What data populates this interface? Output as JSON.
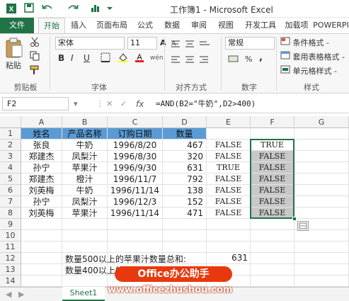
{
  "window": {
    "title": "工作簿1 - Microsoft Excel"
  },
  "tabs": [
    "文件",
    "开始",
    "插入",
    "页面布局",
    "公式",
    "数据",
    "审阅",
    "视图",
    "开发工具",
    "加载项",
    "POWERPI"
  ],
  "ribbon": {
    "clipboard": {
      "paste": "粘贴",
      "label": "剪贴板"
    },
    "font": {
      "name": "宋体",
      "size": "11",
      "bold": "B",
      "italic": "I",
      "underline": "U",
      "grow": "A",
      "shrink": "A",
      "wen": "wén",
      "label": "字体"
    },
    "alignment": {
      "label": "对齐方式"
    },
    "number": {
      "format": "常规",
      "percent": "%",
      "comma": ",",
      "label": "数字"
    },
    "styles": {
      "conditional": "条件格式 -",
      "table": "套用表格格式 -",
      "cell": "单元格样式 -",
      "label": "样式"
    }
  },
  "formula_bar": {
    "name_box": "F2",
    "fx": "fx",
    "formula": "=AND(B2=\"牛奶\",D2>400)"
  },
  "grid": {
    "columns": [
      "A",
      "B",
      "C",
      "D",
      "E",
      "F",
      "G"
    ],
    "rows": [
      "1",
      "2",
      "3",
      "4",
      "5",
      "6",
      "7",
      "8",
      "9",
      "10",
      "11",
      "12",
      "13",
      "14"
    ],
    "header": [
      "姓名",
      "产品名称",
      "订购日期",
      "数量"
    ],
    "data": [
      [
        "张良",
        "牛奶",
        "1996/8/20",
        "467",
        "FALSE",
        "TRUE"
      ],
      [
        "郑建杰",
        "凤梨汁",
        "1996/8/30",
        "320",
        "FALSE",
        "FALSE"
      ],
      [
        "孙宁",
        "苹果汁",
        "1996/9/30",
        "631",
        "TRUE",
        "FALSE"
      ],
      [
        "郑建杰",
        "橙汁",
        "1996/11/7",
        "792",
        "FALSE",
        "FALSE"
      ],
      [
        "刘英梅",
        "牛奶",
        "1996/11/14",
        "138",
        "FALSE",
        "FALSE"
      ],
      [
        "孙宁",
        "凤梨汁",
        "1996/12/3",
        "152",
        "FALSE",
        "FALSE"
      ],
      [
        "刘英梅",
        "苹果汁",
        "1996/11/14",
        "471",
        "FALSE",
        "FALSE"
      ]
    ],
    "note1": "数量500以上的苹果汁数量总和:",
    "note1_value": "631",
    "note2": "数量400以上的牛奶订单数:"
  },
  "sheets": [
    "Sheet1"
  ],
  "watermark": {
    "badge": "Office办公助手",
    "url": "www.officezhushou.com"
  },
  "colors": {
    "accent": "#217346",
    "header_fill": "#5b9bd5",
    "selection": "#217346"
  }
}
